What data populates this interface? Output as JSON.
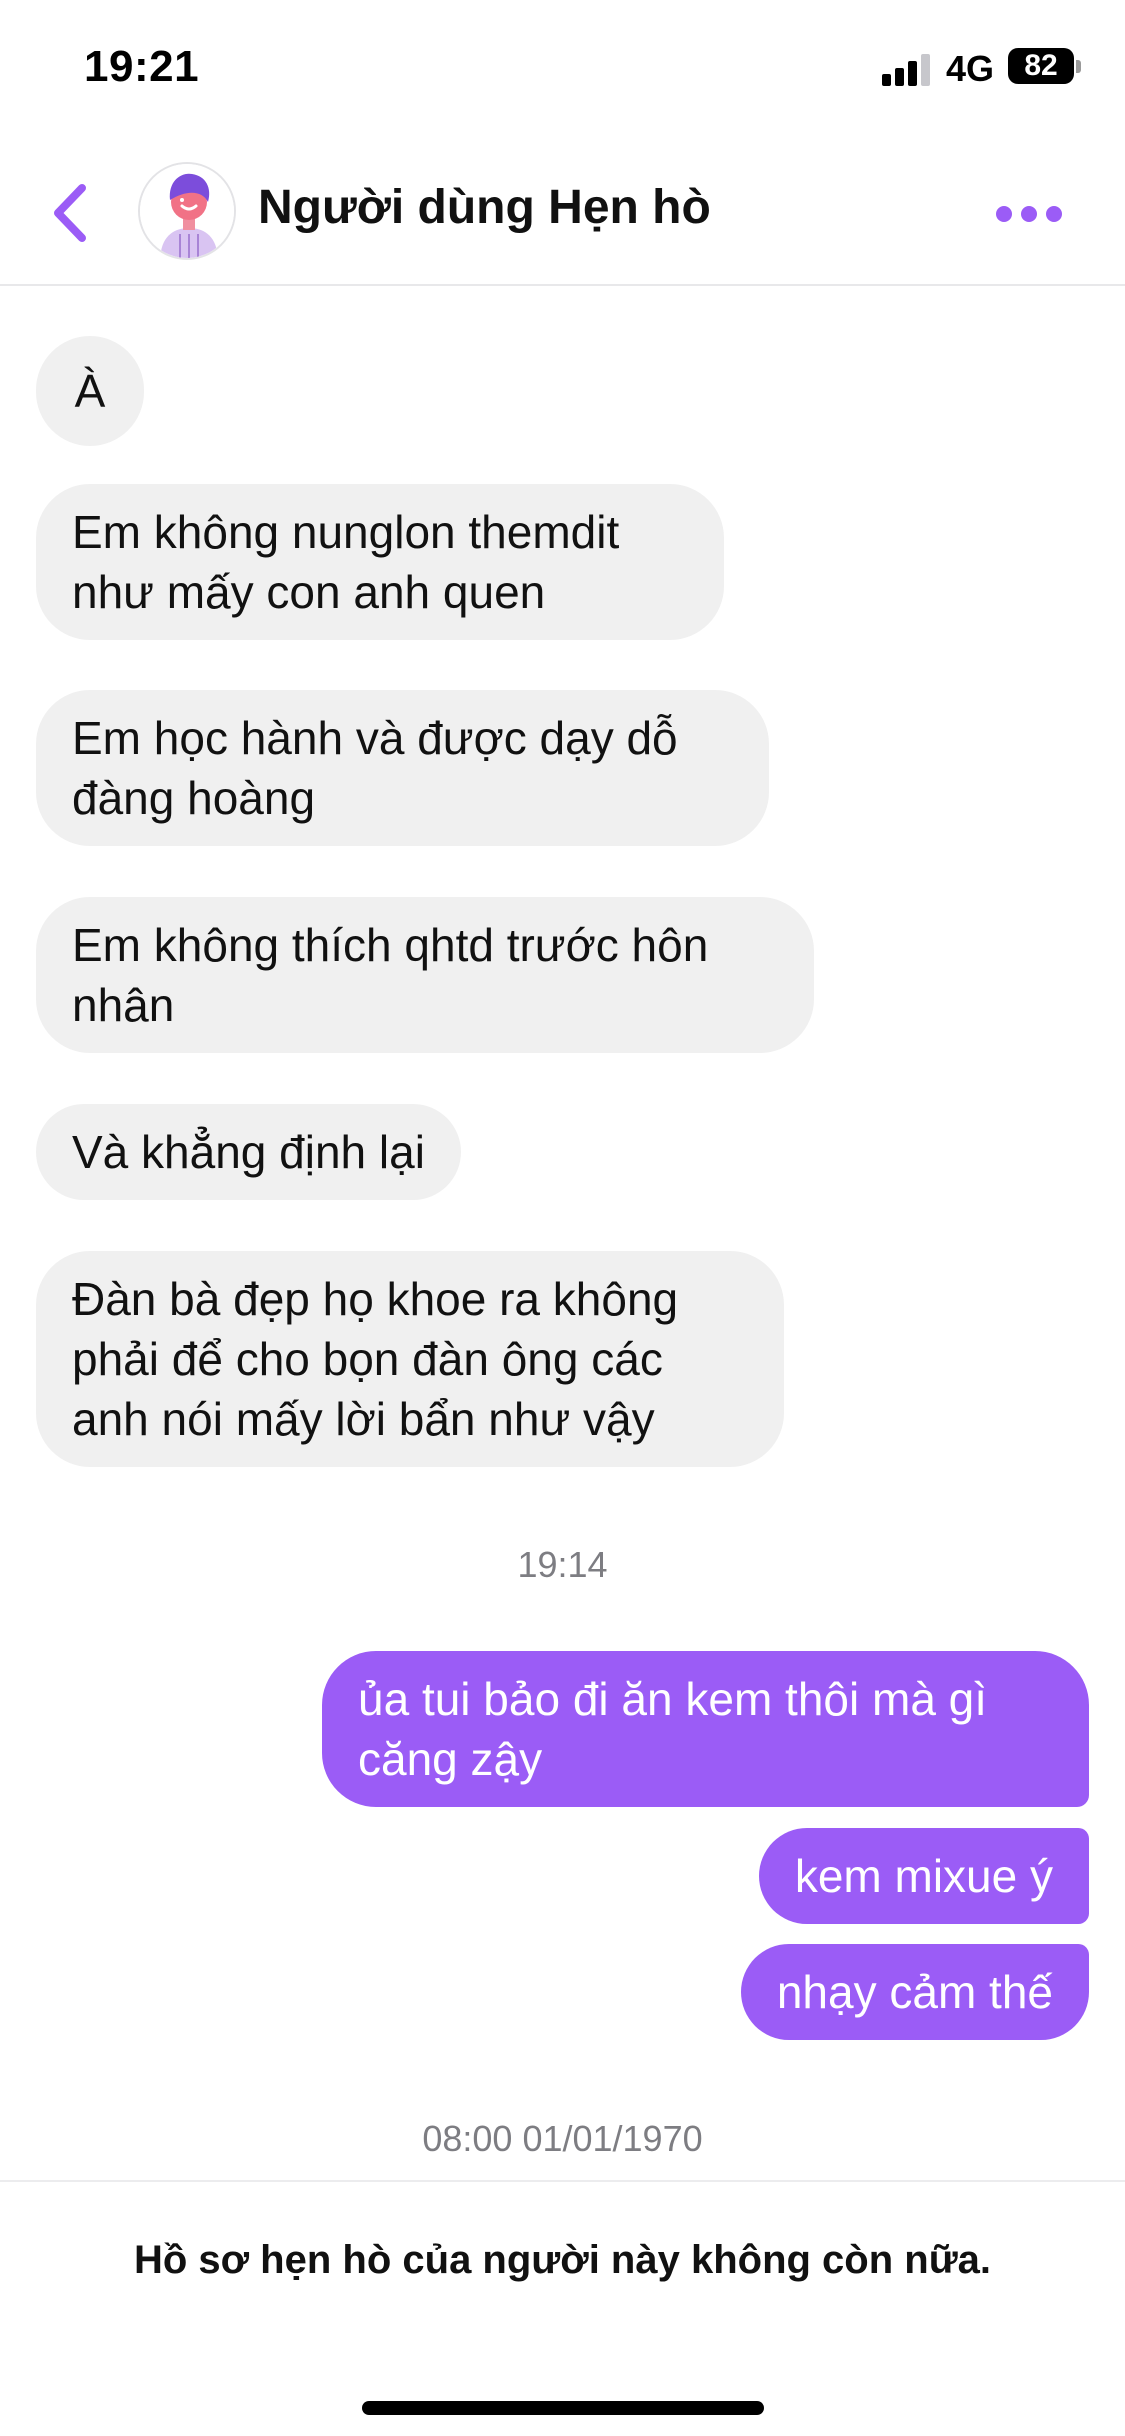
{
  "status_bar": {
    "time": "19:21",
    "network": "4G",
    "battery": "82"
  },
  "header": {
    "title": "Người dùng Hẹn hò",
    "back_icon": "chevron-left-icon",
    "more_icon": "more-horizontal-icon",
    "accent_color": "#9b5cf6"
  },
  "messages": {
    "incoming": [
      "À",
      "Em không nunglon themdit như mấy con anh quen",
      "Em học hành và được dạy dỗ đàng hoàng",
      "Em không thích qhtd trước hôn nhân",
      "Và khẳng định lại",
      "Đàn bà đẹp họ khoe ra không phải để cho bọn đàn ông các anh nói mấy lời bẩn như vậy"
    ],
    "timestamp_1": "19:14",
    "outgoing": [
      "ủa tui bảo đi ăn kem thôi mà gì căng zậy",
      "kem mixue ý",
      "nhạy cảm thế"
    ],
    "timestamp_2": "08:00 01/01/1970"
  },
  "footer": {
    "notice": "Hồ sơ hẹn hò của người này không còn nữa."
  },
  "colors": {
    "incoming_bubble": "#f0f0f0",
    "outgoing_bubble": "#9b5cf6"
  }
}
